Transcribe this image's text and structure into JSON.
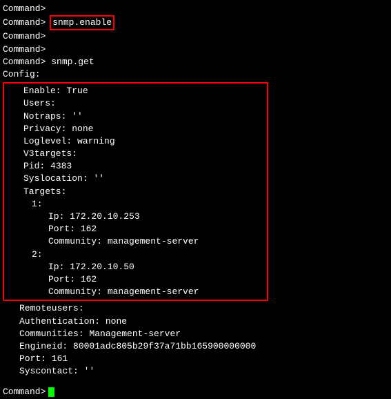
{
  "prompt": "Command>",
  "config_label": "Config:",
  "cmd1": "snmp.enable",
  "cmd2": "snmp.get",
  "cfg": {
    "enable_k": "Enable:",
    "enable_v": "True",
    "users_k": "Users:",
    "notraps_k": "Notraps:",
    "notraps_v": "''",
    "privacy_k": "Privacy:",
    "privacy_v": "none",
    "loglevel_k": "Loglevel:",
    "loglevel_v": "warning",
    "v3targets_k": "V3targets:",
    "pid_k": "Pid:",
    "pid_v": "4383",
    "syslocation_k": "Syslocation:",
    "syslocation_v": "''",
    "targets_k": "Targets:",
    "t1_k": "1:",
    "t1_ip_k": "Ip:",
    "t1_ip_v": "172.20.10.253",
    "t1_port_k": "Port:",
    "t1_port_v": "162",
    "t1_comm_k": "Community:",
    "t1_comm_v": "management-server",
    "t2_k": "2:",
    "t2_ip_k": "Ip:",
    "t2_ip_v": "172.20.10.50",
    "t2_port_k": "Port:",
    "t2_port_v": "162",
    "t2_comm_k": "Community:",
    "t2_comm_v": "management-server",
    "remoteusers_k": "Remoteusers:",
    "auth_k": "Authentication:",
    "auth_v": "none",
    "communities_k": "Communities:",
    "communities_v": "Management-server",
    "engineid_k": "Engineid:",
    "engineid_v": "80001adc805b29f37a71bb165900000000",
    "port_k": "Port:",
    "port_v": "161",
    "syscontact_k": "Syscontact:",
    "syscontact_v": "''"
  }
}
